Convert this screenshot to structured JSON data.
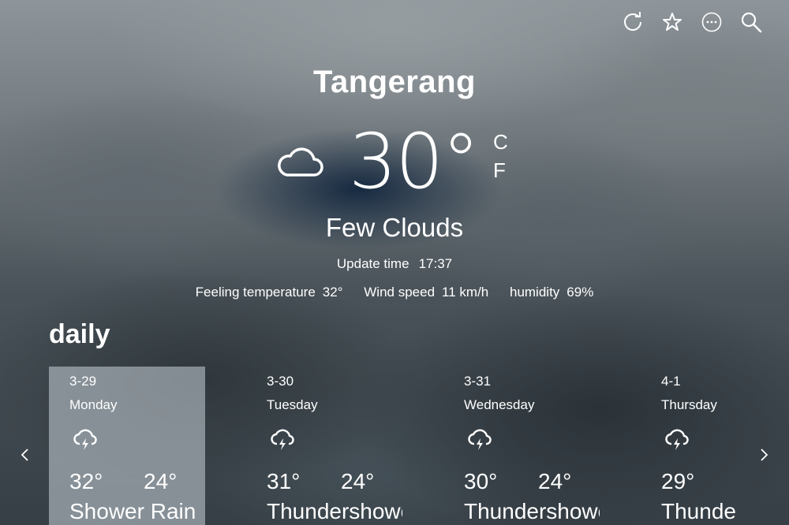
{
  "toolbar": {
    "refresh_icon": "refresh-icon",
    "favorite_icon": "star-icon",
    "more_icon": "more-icon",
    "search_icon": "search-icon"
  },
  "city": "Tangerang",
  "current": {
    "icon": "cloud-icon",
    "temperature": "30°",
    "unit_c": "C",
    "unit_f": "F",
    "condition": "Few Clouds",
    "update_label": "Update time",
    "update_value": "17:37",
    "feeling_label": "Feeling temperature",
    "feeling_value": "32°",
    "wind_label": "Wind speed",
    "wind_value": "11 km/h",
    "humidity_label": "humidity",
    "humidity_value": "69%"
  },
  "daily": {
    "title": "daily",
    "days": [
      {
        "date": "3-29",
        "weekday": "Monday",
        "icon": "thunderstorm-icon",
        "high": "32°",
        "low": "24°",
        "desc": "Shower Rain"
      },
      {
        "date": "3-30",
        "weekday": "Tuesday",
        "icon": "thunderstorm-icon",
        "high": "31°",
        "low": "24°",
        "desc": "Thundershowe"
      },
      {
        "date": "3-31",
        "weekday": "Wednesday",
        "icon": "thunderstorm-icon",
        "high": "30°",
        "low": "24°",
        "desc": "Thundershowe"
      },
      {
        "date": "4-1",
        "weekday": "Thursday",
        "icon": "thunderstorm-icon",
        "high": "29°",
        "low": "",
        "desc": "Thunde"
      }
    ]
  },
  "colors": {
    "text": "#ffffff",
    "selected_card": "#c8d2d8"
  }
}
